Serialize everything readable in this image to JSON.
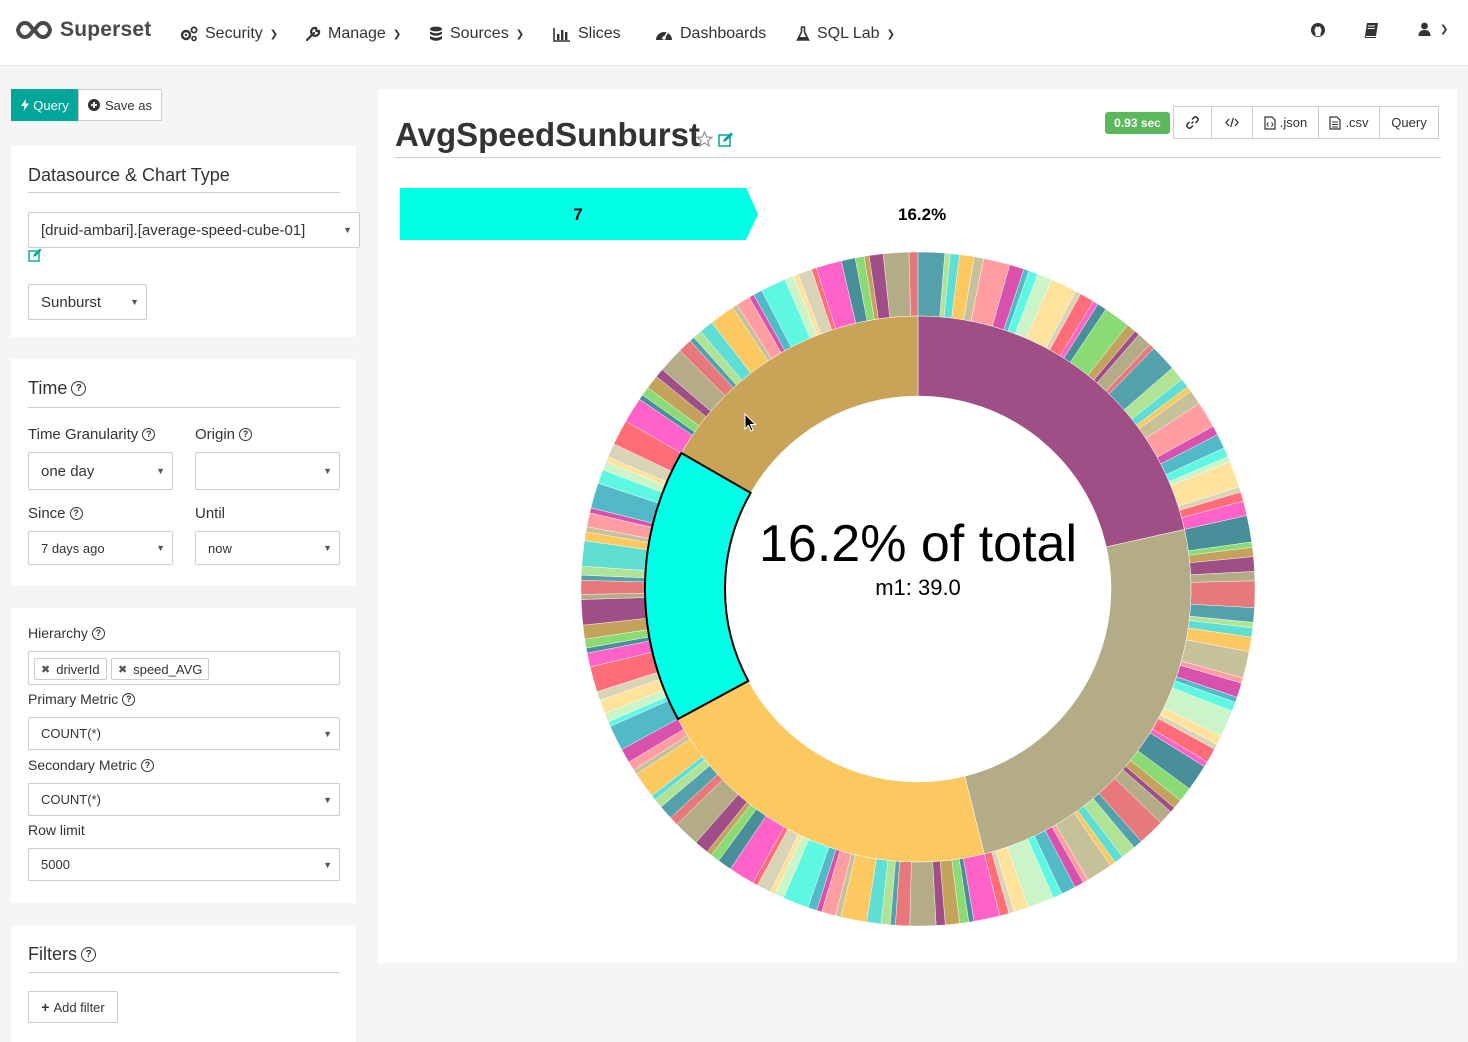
{
  "nav": {
    "brand": "Superset",
    "items": [
      {
        "label": "Security",
        "has_caret": true
      },
      {
        "label": "Manage",
        "has_caret": true
      },
      {
        "label": "Sources",
        "has_caret": true
      },
      {
        "label": "Slices",
        "has_caret": false
      },
      {
        "label": "Dashboards",
        "has_caret": false
      },
      {
        "label": "SQL Lab",
        "has_caret": true
      }
    ]
  },
  "toolbar": {
    "query_label": "Query",
    "save_as_label": "Save as"
  },
  "datasource_panel": {
    "title": "Datasource & Chart Type",
    "datasource": "[druid-ambari].[average-speed-cube-01]",
    "chart_type": "Sunburst"
  },
  "time_panel": {
    "title": "Time",
    "granularity_label": "Time Granularity",
    "granularity_value": "one day",
    "origin_label": "Origin",
    "origin_value": "",
    "since_label": "Since",
    "since_value": "7 days ago",
    "until_label": "Until",
    "until_value": "now"
  },
  "hierarchy_panel": {
    "hierarchy_label": "Hierarchy",
    "hierarchy_tags": [
      "driverId",
      "speed_AVG"
    ],
    "primary_metric_label": "Primary Metric",
    "primary_metric_value": "COUNT(*)",
    "secondary_metric_label": "Secondary Metric",
    "secondary_metric_value": "COUNT(*)",
    "row_limit_label": "Row limit",
    "row_limit_value": "5000"
  },
  "filters_panel": {
    "title": "Filters",
    "add_filter_label": "Add filter"
  },
  "chart_header": {
    "title": "AvgSpeedSunburst",
    "timer": "0.93 sec",
    "json_label": ".json",
    "csv_label": ".csv",
    "query_label": "Query"
  },
  "chart_data": {
    "type": "sunburst",
    "breadcrumb": [
      "7"
    ],
    "breadcrumb_percentage": "16.2%",
    "center_title": "16.2% of total",
    "center_subtitle": "m1: 39.0",
    "inner_ring": [
      {
        "label": "(purple)",
        "percent": 21.5,
        "color": "#a04f86"
      },
      {
        "label": "(khaki)",
        "percent": 24.6,
        "color": "#b4ac87"
      },
      {
        "label": "(yellow)",
        "percent": 21.0,
        "color": "#fcc960"
      },
      {
        "label": "7",
        "percent": 16.2,
        "color": "#00ffe7",
        "highlight": true
      },
      {
        "label": "(tan)",
        "percent": 16.7,
        "color": "#c9a458"
      }
    ],
    "colors": [
      "#54a1ac",
      "#afe396",
      "#5fded4",
      "#fcc960",
      "#c6c199",
      "#ff9da2",
      "#d852ad",
      "#52b9c6",
      "#5ef8e2",
      "#cbf4c8",
      "#ffe29b",
      "#d9d4b5",
      "#ff6d78",
      "#ff62c9",
      "#488f9a",
      "#8adb74",
      "#c3a35c",
      "#a04f86",
      "#b4ac87",
      "#e7797d"
    ]
  }
}
